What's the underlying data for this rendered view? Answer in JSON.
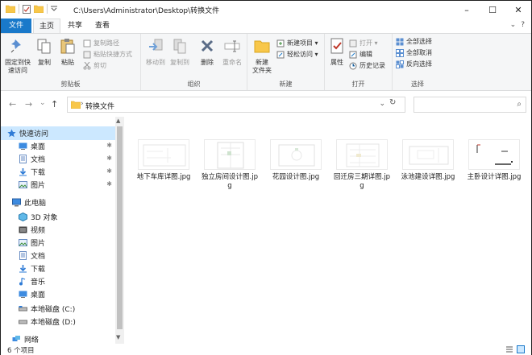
{
  "window": {
    "title_path": "C:\\Users\\Administrator\\Desktop\\转换文件",
    "controls": [
      "–",
      "☐",
      "✕"
    ]
  },
  "tabs": {
    "file": "文件",
    "home": "主页",
    "share": "共享",
    "view": "查看",
    "expand": "⌄",
    "help": "?"
  },
  "ribbon": {
    "clipboard": {
      "label": "剪贴板",
      "pin": "固定到快\n速访问",
      "copy": "复制",
      "paste": "粘贴",
      "copy_path": "复制路径",
      "paste_shortcut": "粘贴快捷方式",
      "cut": "剪切"
    },
    "organize": {
      "label": "组织",
      "move_to": "移动到",
      "copy_to": "复制到",
      "delete": "删除",
      "rename": "重命名"
    },
    "new": {
      "label": "新建",
      "new_folder": "新建\n文件夹",
      "new_item": "新建项目 ▾",
      "easy_access": "轻松访问 ▾"
    },
    "open": {
      "label": "打开",
      "properties": "属性",
      "open": "打开 ▾",
      "edit": "编辑",
      "history": "历史记录"
    },
    "select": {
      "label": "选择",
      "select_all": "全部选择",
      "select_none": "全部取消",
      "invert": "反向选择"
    }
  },
  "address": {
    "back": "←",
    "forward": "→",
    "recent": "⌄",
    "up": "↑",
    "chevron": "›",
    "path": "转换文件",
    "dropdown": "⌄",
    "refresh": "↻",
    "search_icon": "⌕"
  },
  "nav": {
    "quick_access": "快速访问",
    "desktop": "桌面",
    "documents": "文档",
    "downloads": "下载",
    "pictures": "图片",
    "this_pc": "此电脑",
    "objects3d": "3D 对象",
    "videos": "视频",
    "pictures2": "图片",
    "documents2": "文档",
    "downloads2": "下载",
    "music": "音乐",
    "desktop2": "桌面",
    "drive_c": "本地磁盘 (C:)",
    "drive_d": "本地磁盘 (D:)",
    "network": "网络",
    "pin": "✱"
  },
  "files": [
    {
      "name": "地下车库详图.jpg"
    },
    {
      "name": "独立房间设计图.jpg"
    },
    {
      "name": "花园设计图.jpg"
    },
    {
      "name": "回迁房三期详图.jpg"
    },
    {
      "name": "泳池建设详图.jpg"
    },
    {
      "name": "主卧设计详图.jpg"
    }
  ],
  "status": {
    "count": "6 个项目"
  },
  "colors": {
    "accent": "#1979ca",
    "selection": "#cce8ff",
    "folder": "#f8c74a"
  }
}
